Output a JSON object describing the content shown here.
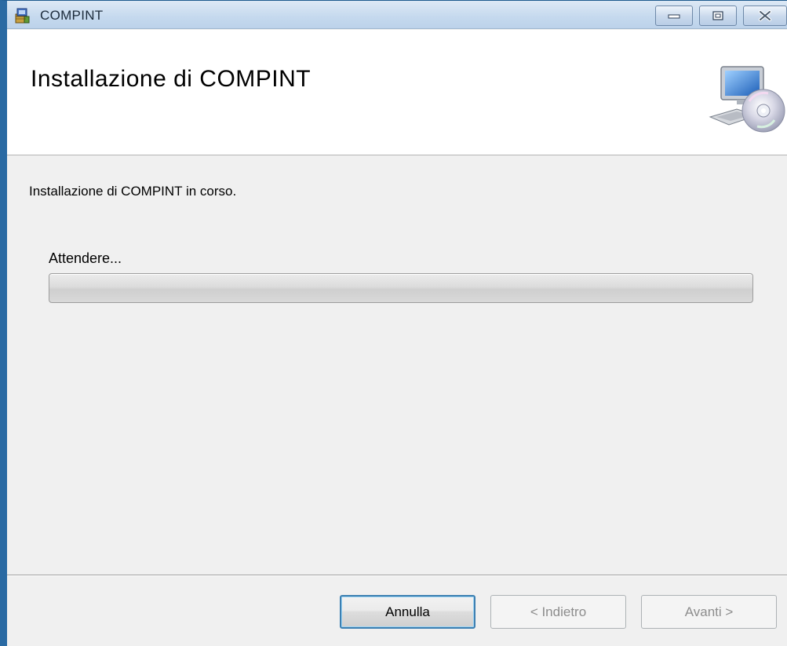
{
  "window": {
    "title": "COMPINT",
    "controls": {
      "minimize_icon": "minimize-icon",
      "maximize_icon": "maximize-icon",
      "close_icon": "close-icon"
    }
  },
  "banner": {
    "title": "Installazione di COMPINT",
    "icon": "computer-disc-icon"
  },
  "body": {
    "status": "Installazione di COMPINT in corso.",
    "wait_label": "Attendere...",
    "progress_fraction": 0
  },
  "footer": {
    "cancel_label": "Annulla",
    "back_label": "< Indietro",
    "next_label": "Avanti >"
  },
  "colors": {
    "window_border": "#2a6aa3",
    "accent_focus": "#3c7fb1",
    "background": "#f0f0f0"
  }
}
